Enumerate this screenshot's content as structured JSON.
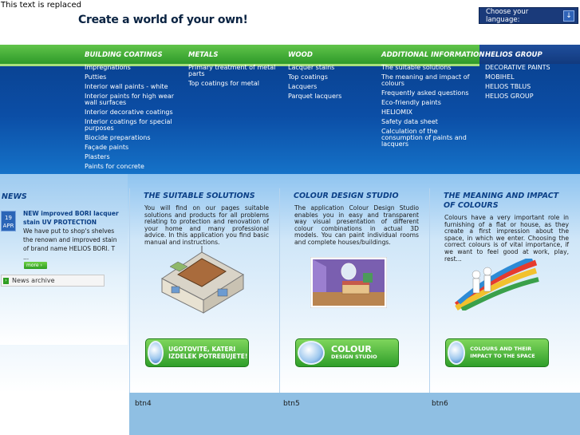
{
  "header": {
    "replaced_text": "This text is replaced",
    "slogan": "Create a world of your own!",
    "language_label": "Choose your language:"
  },
  "menu": {
    "columns": [
      {
        "title": "BUILDING COATINGS",
        "items": [
          "Impregnations",
          "Putties",
          "Interior wall paints - white",
          "Interior paints for high wear wall surfaces",
          "Interior decorative coatings",
          "Interior coatings for special purposes",
          "Biocide preparations",
          "Façade paints",
          "Plasters",
          "Paints for concrete"
        ]
      },
      {
        "title": "METALS",
        "items": [
          "Primary treatment of metal parts",
          "Top coatings for metal"
        ]
      },
      {
        "title": "WOOD",
        "items": [
          "Lacquer stains",
          "Top coatings",
          "Lacquers",
          "Parquet lacquers"
        ]
      },
      {
        "title": "ADDITIONAL INFORMATION",
        "items": [
          "The suitable solutions",
          "The meaning and impact of colours",
          "Frequently asked questions",
          "Eco-friendly paints",
          "HELIOMIX",
          "Safety data sheet",
          "Calculation of the consumption of paints and lacquers"
        ]
      },
      {
        "title": "HELIOS GROUP",
        "items": [
          "DECORATIVE PAINTS",
          "MOBIHEL",
          "HELIOS TBLUS",
          "HELIOS GROUP"
        ]
      }
    ]
  },
  "news": {
    "title": "NEWS",
    "day": "19",
    "month": "APR",
    "headline": "NEW improved BORI lacquer stain UV PROTECTION",
    "text": "We have put to shop's shelves the renown and improved stain of brand name HELIOS BORI. T ...",
    "more_label": "more",
    "archive_label": "News archive"
  },
  "panels": [
    {
      "title": "THE SUITABLE SOLUTIONS",
      "text": "You will find on our pages suitable solutions and products for all problems relating to protection and renovation of your home and many professional advice. In this application you find basic manual and instructions.",
      "cta": "UGOTOVITE, KATERI IZDELEK POTREBUJETE!"
    },
    {
      "title": "COLOUR DESIGN STUDIO",
      "text": "The application Colour Design Studio enables you in easy and transparent way visual presentation of different colour combinations in actual 3D models. You can paint individual rooms and complete houses/buildings.",
      "cta_big": "COLOUR",
      "cta_small": "DESIGN STUDIO"
    },
    {
      "title": "THE MEANING AND IMPACT OF COLOURS",
      "text": "Colours have a very important role in furnishing of a flat or house, as they create a first impression about the space, in which we enter. Choosing the correct colours is of vital importance, if we want to feel good at work, play, rest...",
      "cta": "COLOURS AND THEIR IMPACT TO THE SPACE"
    }
  ],
  "bottom_buttons": [
    "btn4",
    "btn5",
    "btn6"
  ]
}
